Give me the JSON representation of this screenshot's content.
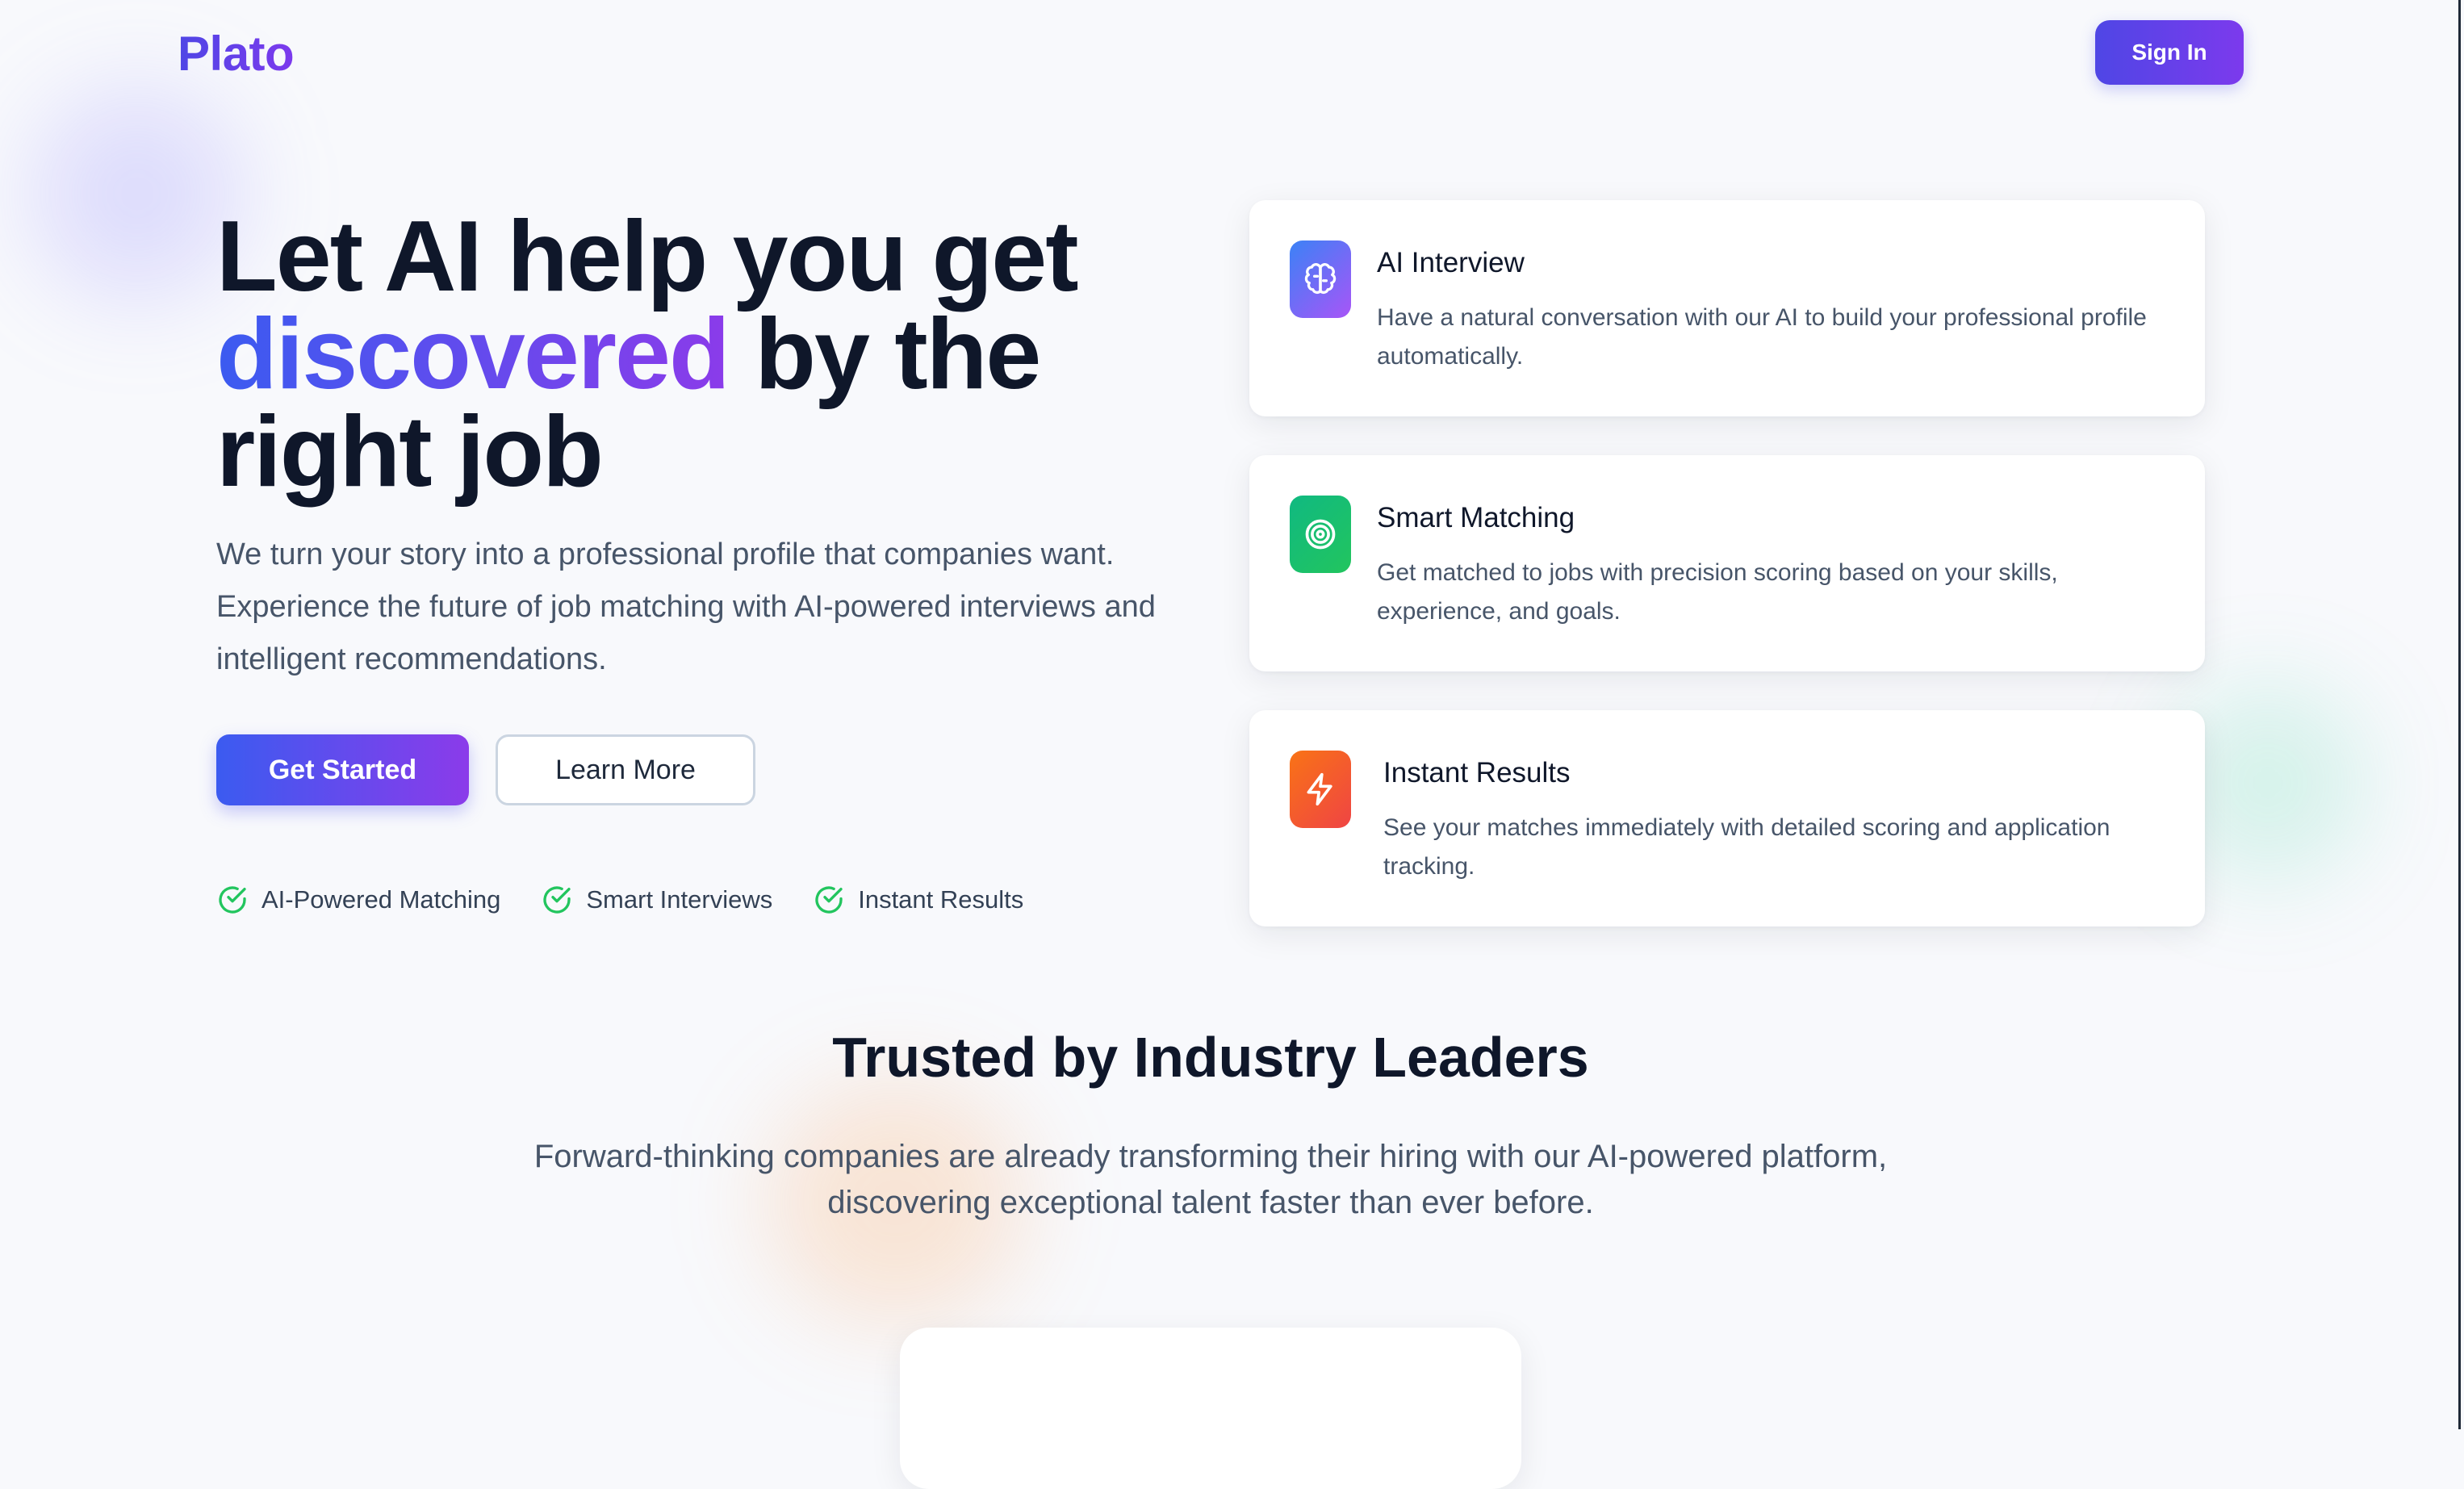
{
  "header": {
    "brand": "Plato",
    "sign_in_label": "Sign In"
  },
  "hero": {
    "title_line1": "Let AI help you get",
    "title_highlight": "discovered",
    "title_line2_rest": "by the",
    "title_line3": "right job",
    "description": "We turn your story into a professional profile that companies want. Experience the future of job matching with AI-powered interviews and intelligent recommendations.",
    "primary_button": "Get Started",
    "secondary_button": "Learn More",
    "features": [
      {
        "label": "AI-Powered Matching",
        "icon": "check-circle-icon"
      },
      {
        "label": "Smart Interviews",
        "icon": "check-circle-icon"
      },
      {
        "label": "Instant Results",
        "icon": "check-circle-icon"
      }
    ]
  },
  "cards": [
    {
      "title": "AI Interview",
      "description": "Have a natural conversation with our AI to build your professional profile automatically.",
      "icon": "brain-icon",
      "color": "#8b5cf6"
    },
    {
      "title": "Smart Matching",
      "description": "Get matched to jobs with precision scoring based on your skills, experience, and goals.",
      "icon": "target-icon",
      "color": "#10b981"
    },
    {
      "title": "Instant Results",
      "description": "See your matches immediately with detailed scoring and application tracking.",
      "icon": "lightning-icon",
      "color": "#f97316"
    }
  ],
  "trusted": {
    "title": "Trusted by Industry Leaders",
    "description": "Forward-thinking companies are already transforming their hiring with our AI-powered platform, discovering exceptional talent faster than ever before."
  },
  "colors": {
    "accent_start": "#3b5bf0",
    "accent_end": "#8b3bea",
    "check_green": "#22c55e"
  }
}
